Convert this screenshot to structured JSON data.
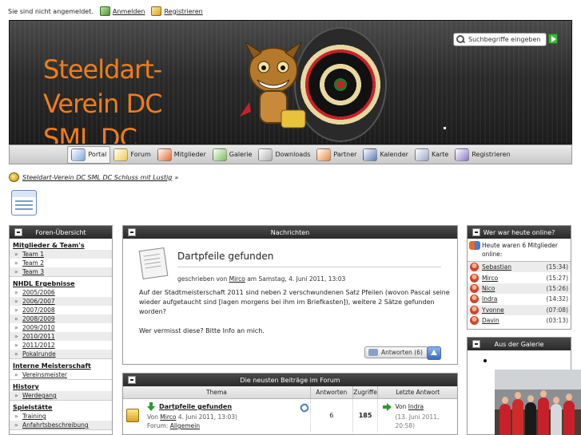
{
  "userbar": {
    "status": "Sie sind nicht angemeldet.",
    "login_label": "Anmelden",
    "register_label": "Registrieren"
  },
  "header": {
    "title_lines": [
      "Steeldart-",
      "Verein DC",
      "SML DC"
    ],
    "search_placeholder": "Suchbegriffe eingeben"
  },
  "nav": {
    "items": [
      {
        "label": "Portal",
        "icon": "portal-icon",
        "color": "#7ea6e0",
        "active": true
      },
      {
        "label": "Forum",
        "icon": "forum-icon",
        "color": "#f2c94c",
        "active": false
      },
      {
        "label": "Mitglieder",
        "icon": "members-icon",
        "color": "#e46a2e",
        "active": false
      },
      {
        "label": "Galerie",
        "icon": "gallery-icon",
        "color": "#7bbf5a",
        "active": false
      },
      {
        "label": "Downloads",
        "icon": "downloads-icon",
        "color": "#b0b0b0",
        "active": false
      },
      {
        "label": "Partner",
        "icon": "partner-icon",
        "color": "#e88a3a",
        "active": false
      },
      {
        "label": "Kalender",
        "icon": "calendar-icon",
        "color": "#5a7ab8",
        "active": false
      },
      {
        "label": "Karte",
        "icon": "map-icon",
        "color": "#9aa6c8",
        "active": false
      },
      {
        "label": "Registrieren",
        "icon": "register-icon",
        "color": "#8a78c8",
        "active": false
      }
    ]
  },
  "breadcrumb": {
    "label": "Steeldart-Verein DC SML DC Schluss mit Lustig",
    "separator": "»"
  },
  "forum_overview": {
    "title": "Foren-Übersicht",
    "categories": [
      {
        "name": "Mitglieder & Team's",
        "items": [
          "Team 1",
          "Team 2",
          "Team 3"
        ]
      },
      {
        "name": "NHDL Ergebnisse",
        "items": [
          "2005/2006",
          "2006/2007",
          "2007/2008",
          "2008/2009",
          "2009/2010",
          "2010/2011",
          "2011/2012",
          "Pokalrunde"
        ]
      },
      {
        "name": "Interne Meisterschaft",
        "items": [
          "Vereinsmeister"
        ]
      },
      {
        "name": "History",
        "items": [
          "Werdegang"
        ]
      },
      {
        "name": "Spielstätte",
        "items": [
          "Training",
          "Anfahrtsbeschreibung"
        ]
      }
    ]
  },
  "news": {
    "panel_title": "Nachrichten",
    "post_title": "Dartpfeile gefunden",
    "meta_prefix": "geschrieben von",
    "author": "Mirco",
    "meta_date": "am Samstag, 4. Juni 2011, 13:03",
    "body": [
      "Auf der Stadtmeisterschaft 2011 sind neben 2 verschwundenen Satz Pfeilen (wovon Pascal seine wieder aufgetaucht sind [lagen morgens bei ihm im Briefkasten]), weitere 2 Sätze gefunden worden?",
      "Wer vermisst diese? Bitte Info an mich."
    ],
    "reply_label": "Antworten (6)"
  },
  "latest": {
    "panel_title": "Die neusten Beiträge im Forum",
    "columns": [
      "Thema",
      "Antworten",
      "Zugriffe",
      "Letzte Antwort"
    ],
    "rows": [
      {
        "title": "Dartpfeile gefunden",
        "by_prefix": "Von",
        "author": "Mirco",
        "date": "4. Juni 2011, 13:03)",
        "forum_prefix": "Forum:",
        "forum": "Allgemein",
        "answers": "6",
        "views": "185",
        "last_prefix": "Von",
        "last_author": "Indra",
        "last_date": "(13. Juni 2011, 20:58)"
      }
    ]
  },
  "online_today": {
    "title": "Wer war heute online?",
    "intro": "Heute waren 6 Mitglieder online:",
    "users": [
      {
        "name": "Sebastian",
        "time": "(15:34)"
      },
      {
        "name": "Mirco",
        "time": "(15:27)"
      },
      {
        "name": "Nico",
        "time": "(15:26)"
      },
      {
        "name": "Indra",
        "time": "(14:32)"
      },
      {
        "name": "Yvonne",
        "time": "(07:08)"
      },
      {
        "name": "Davin",
        "time": "(03:13)"
      }
    ]
  },
  "gallery": {
    "title": "Aus der Galerie"
  },
  "colors": {
    "title_orange": "#f07d1a",
    "panel_header": "#2a2a2a",
    "link": "#1a1a1a"
  }
}
